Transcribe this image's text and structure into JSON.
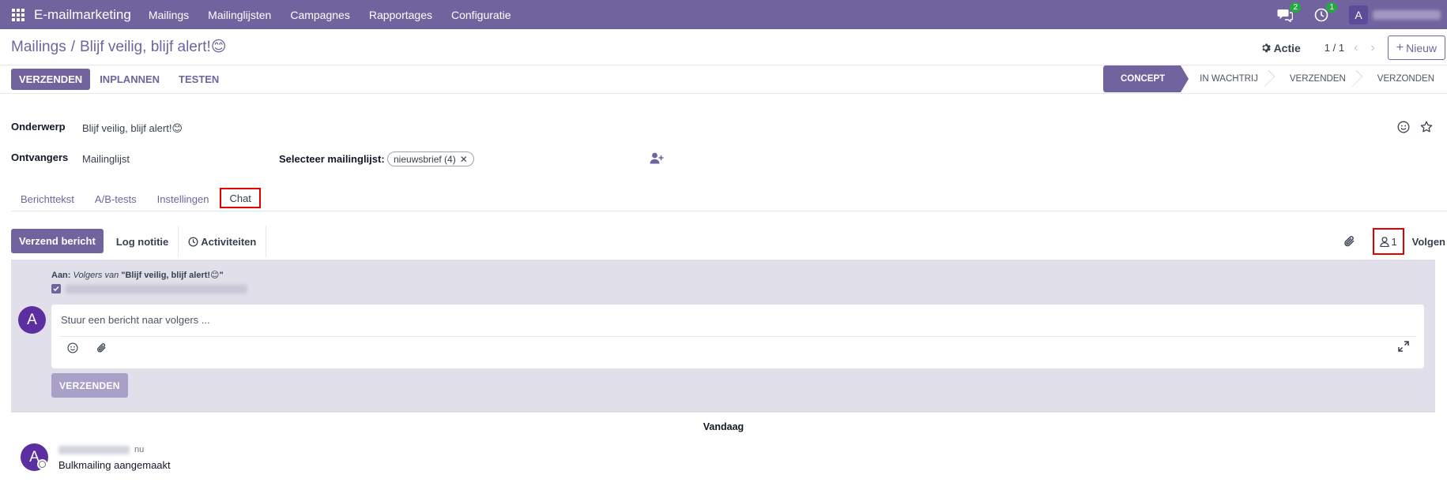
{
  "navbar": {
    "app_name": "E-mailmarketing",
    "menu": [
      "Mailings",
      "Mailinglijsten",
      "Campagnes",
      "Rapportages",
      "Configuratie"
    ],
    "messages_badge": "2",
    "activities_badge": "1",
    "avatar_letter": "A"
  },
  "control_panel": {
    "breadcrumb_parent": "Mailings",
    "breadcrumb_sep": "/",
    "breadcrumb_current": "Blijf veilig, blijf alert!😊",
    "action_label": "Actie",
    "pager": "1 / 1",
    "new_label": "Nieuw"
  },
  "statusbar": {
    "buttons": [
      "VERZENDEN",
      "INPLANNEN",
      "TESTEN"
    ],
    "stages": [
      "CONCEPT",
      "IN WACHTRIJ",
      "VERZENDEN",
      "VERZONDEN"
    ],
    "active_stage": "CONCEPT"
  },
  "form": {
    "subject_label": "Onderwerp",
    "subject_value": "Blijf veilig, blijf alert!😊",
    "recipients_label": "Ontvangers",
    "recipients_value": "Mailinglijst",
    "mailinglist_label": "Selecteer mailinglijst:",
    "mailinglist_tag": "nieuwsbrief (4)"
  },
  "tabs": [
    "Berichttekst",
    "A/B-tests",
    "Instellingen",
    "Chat"
  ],
  "chatter": {
    "send_message": "Verzend bericht",
    "log_note": "Log notitie",
    "activities": "Activiteiten",
    "followers_count": "1",
    "follow_label": "Volgen",
    "to_prefix": "Aan:",
    "to_followers": "Volgers van",
    "to_record": "\"Blijf veilig, blijf alert!😊\"",
    "composer_placeholder": "Stuur een bericht naar volgers ...",
    "send_button": "VERZENDEN",
    "avatar_letter": "A"
  },
  "messages": {
    "day_separator": "Vandaag",
    "items": [
      {
        "avatar_letter": "A",
        "time": "nu",
        "body": "Bulkmailing aangemaakt"
      }
    ]
  },
  "colors": {
    "brand": "#71639e",
    "highlight": "#e00000",
    "avatar": "#5b2fa0"
  }
}
